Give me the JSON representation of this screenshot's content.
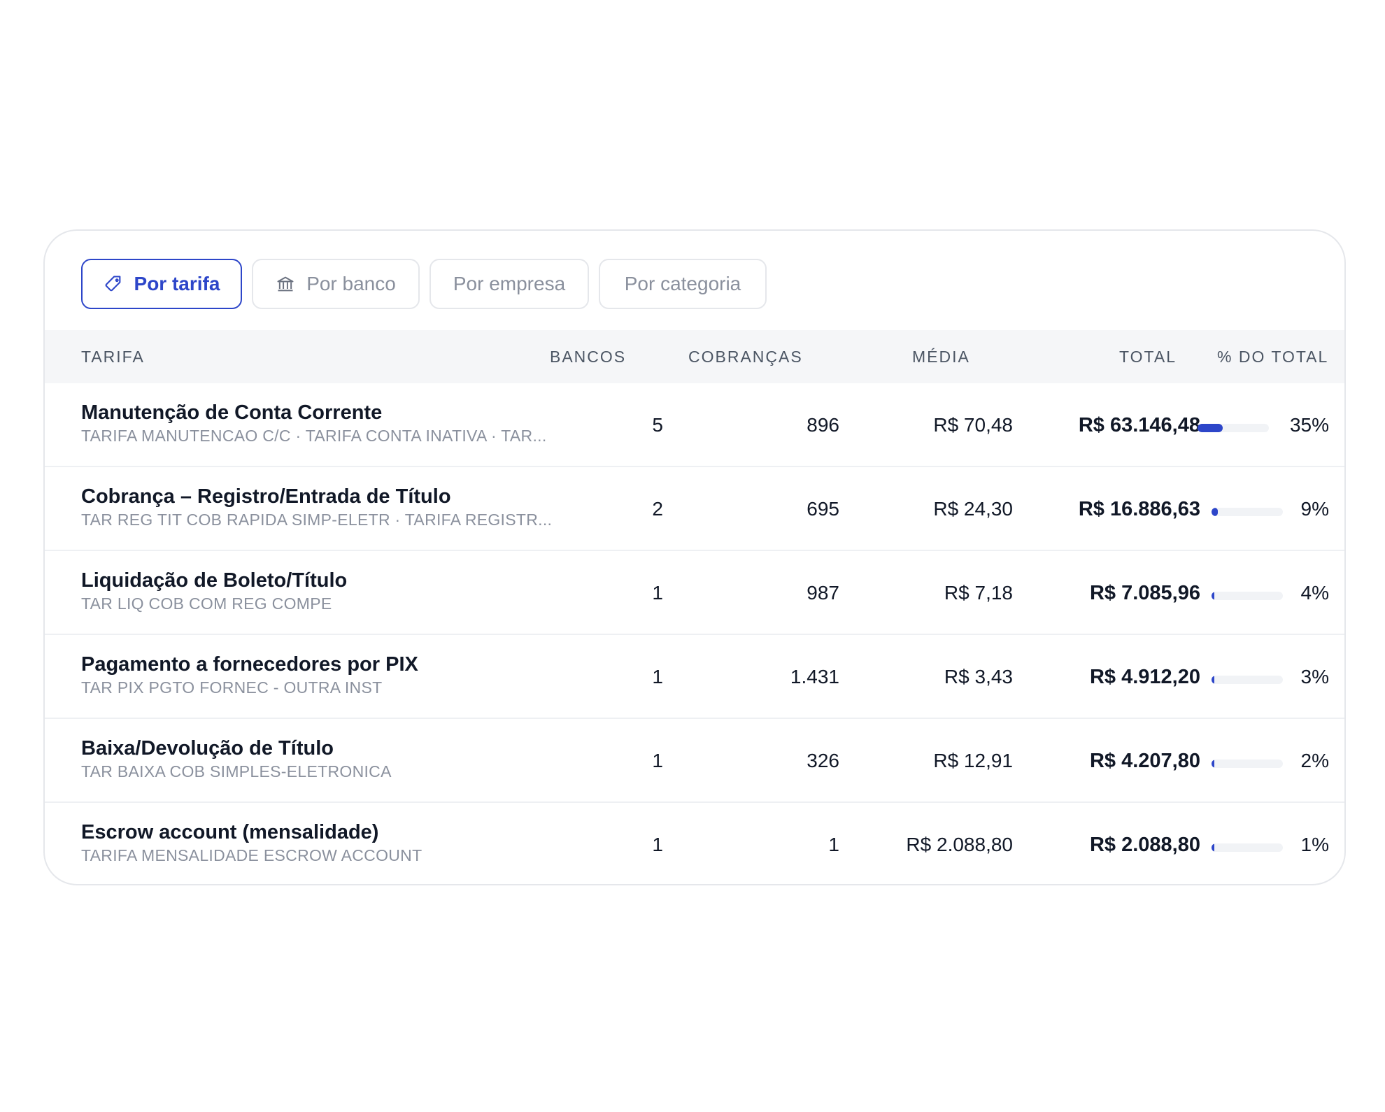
{
  "tabs": [
    {
      "label": "Por tarifa",
      "icon": "tag-icon",
      "active": true
    },
    {
      "label": "Por banco",
      "icon": "bank-icon",
      "active": false
    },
    {
      "label": "Por empresa",
      "active": false
    },
    {
      "label": "Por categoria",
      "active": false
    }
  ],
  "columns": {
    "tarifa": "TARIFA",
    "bancos": "BANCOS",
    "cobrancas": "COBRANÇAS",
    "media": "MÉDIA",
    "total": "TOTAL",
    "pct": "% DO TOTAL"
  },
  "rows": [
    {
      "name": "Manutenção de Conta Corrente",
      "desc": "TARIFA MANUTENCAO C/C · TARIFA CONTA INATIVA · TAR...",
      "bancos": "5",
      "cobrancas": "896",
      "media": "R$ 70,48",
      "total": "R$ 63.146,48",
      "pct": "35%",
      "pct_value": 0.35
    },
    {
      "name": "Cobrança – Registro/Entrada de Título",
      "desc": "TAR REG TIT COB RAPIDA SIMP-ELETR · TARIFA REGISTR...",
      "bancos": "2",
      "cobrancas": "695",
      "media": "R$ 24,30",
      "total": "R$ 16.886,63",
      "pct": "9%",
      "pct_value": 0.09
    },
    {
      "name": "Liquidação de Boleto/Título",
      "desc": "TAR LIQ COB COM REG COMPE",
      "bancos": "1",
      "cobrancas": "987",
      "media": "R$ 7,18",
      "total": "R$ 7.085,96",
      "pct": "4%",
      "pct_value": 0.04
    },
    {
      "name": "Pagamento a fornecedores por PIX",
      "desc": "TAR PIX PGTO FORNEC - OUTRA INST",
      "bancos": "1",
      "cobrancas": "1.431",
      "media": "R$ 3,43",
      "total": "R$ 4.912,20",
      "pct": "3%",
      "pct_value": 0.03
    },
    {
      "name": "Baixa/Devolução de Título",
      "desc": "TAR BAIXA COB SIMPLES-ELETRONICA",
      "bancos": "1",
      "cobrancas": "326",
      "media": "R$ 12,91",
      "total": "R$ 4.207,80",
      "pct": "2%",
      "pct_value": 0.02
    },
    {
      "name": "Escrow account (mensalidade)",
      "desc": "TARIFA MENSALIDADE ESCROW ACCOUNT",
      "bancos": "1",
      "cobrancas": "1",
      "media": "R$ 2.088,80",
      "total": "R$ 2.088,80",
      "pct": "1%",
      "pct_value": 0.01
    }
  ],
  "colors": {
    "accent": "#2d46c9",
    "muted": "#8a909d",
    "header_bg": "#f5f6f8"
  }
}
